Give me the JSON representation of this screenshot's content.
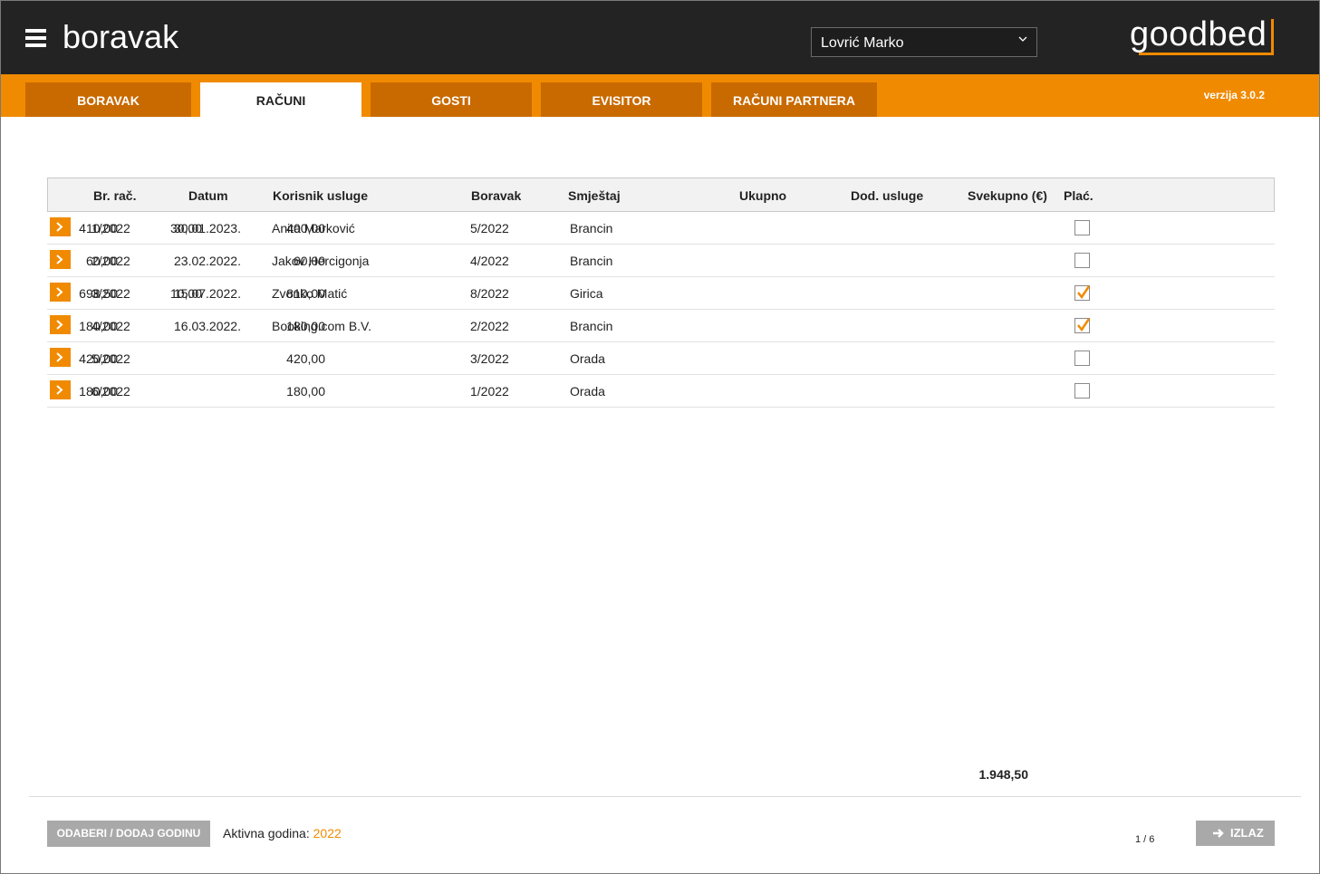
{
  "header": {
    "app_title": "boravak",
    "user_selected": "Lovrić Marko",
    "logo": "goodbed"
  },
  "tabs": [
    {
      "label": "BORAVAK",
      "active": false
    },
    {
      "label": "RAČUNI",
      "active": true
    },
    {
      "label": "GOSTI",
      "active": false
    },
    {
      "label": "EVISITOR",
      "active": false
    },
    {
      "label": "RAČUNI PARTNERA",
      "active": false
    }
  ],
  "version": "verzija 3.0.2",
  "table": {
    "columns": [
      "Br. rač.",
      "Datum",
      "Korisnik usluge",
      "Boravak",
      "Smještaj",
      "Ukupno",
      "Dod. usluge",
      "Svekupno (€)",
      "Plać."
    ],
    "rows": [
      {
        "br": "1/2022",
        "datum": "30.01.2023.",
        "korisnik": "Anita Marković",
        "boravak": "5/2022",
        "smjestaj": "Brancin",
        "ukupno": "400,00",
        "dod": "30,00",
        "svekupno": "410,00",
        "placeno": false
      },
      {
        "br": "2/2022",
        "datum": "23.02.2022.",
        "korisnik": "Jakov Hercigonja",
        "boravak": "4/2022",
        "smjestaj": "Brancin",
        "ukupno": "60,00",
        "dod": "",
        "svekupno": "60,00",
        "placeno": false
      },
      {
        "br": "3/2022",
        "datum": "15.07.2022.",
        "korisnik": "Zvonko Matić",
        "boravak": "8/2022",
        "smjestaj": "Girica",
        "ukupno": "810,00",
        "dod": "10,00",
        "svekupno": "698,50",
        "placeno": true
      },
      {
        "br": "4/2022",
        "datum": "16.03.2022.",
        "korisnik": "Booking.com B.V.",
        "boravak": "2/2022",
        "smjestaj": "Brancin",
        "ukupno": "180,00",
        "dod": "",
        "svekupno": "180,00",
        "placeno": true
      },
      {
        "br": "5/2022",
        "datum": "",
        "korisnik": "",
        "boravak": "3/2022",
        "smjestaj": "Orada",
        "ukupno": "420,00",
        "dod": "",
        "svekupno": "420,00",
        "placeno": false
      },
      {
        "br": "6/2022",
        "datum": "",
        "korisnik": "",
        "boravak": "1/2022",
        "smjestaj": "Orada",
        "ukupno": "180,00",
        "dod": "",
        "svekupno": "180,00",
        "placeno": false
      }
    ],
    "total": "1.948,50"
  },
  "footer": {
    "year_button": "ODABERI / DODAJ GODINU",
    "active_year_label": "Aktivna godina:",
    "active_year": "2022",
    "pager": "1 / 6",
    "exit_button": "IZLAZ"
  },
  "colors": {
    "accent": "#f08a00",
    "tab_inactive": "#c96a00",
    "topbar": "#232323"
  }
}
